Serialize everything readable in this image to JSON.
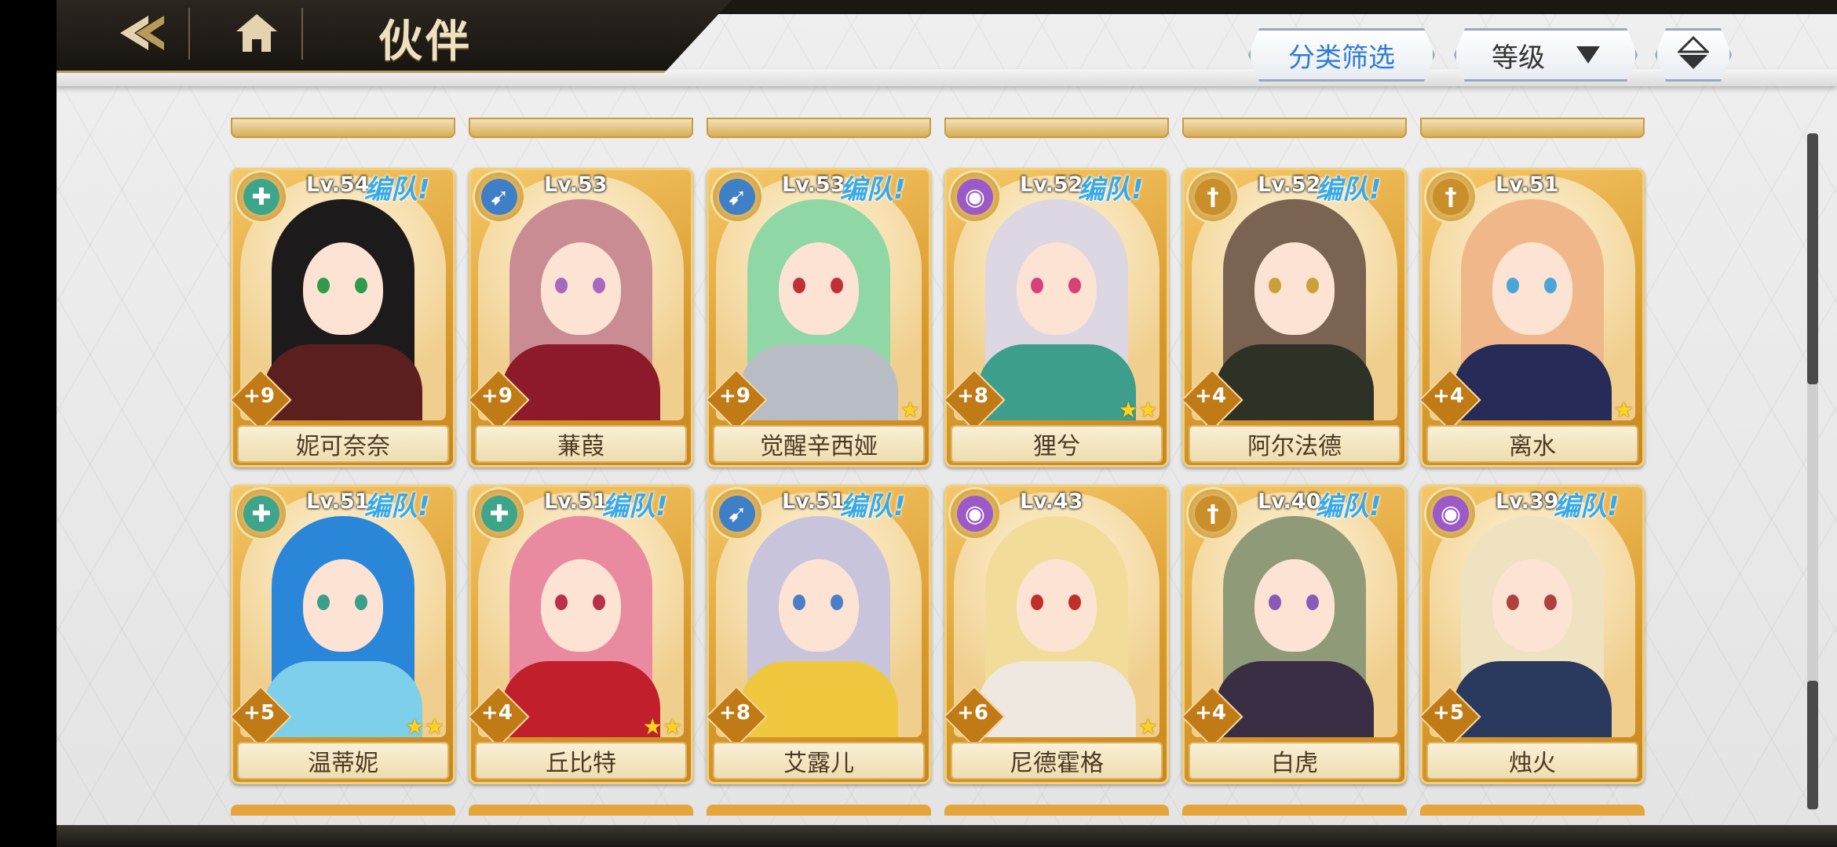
{
  "header": {
    "title": "伙伴",
    "filter_label": "分类筛选",
    "sort_label": "等级",
    "back_icon": "back-arrow-icon",
    "home_icon": "home-icon",
    "order_icon": "sort-order-icon"
  },
  "cards": [
    {
      "name": "妮可奈奈",
      "level": "Lv.54",
      "team": "编队!",
      "plus": "+9",
      "stars": 0,
      "class": "cross",
      "hair": "#1d1a1c",
      "body": "#5a1f1e",
      "eye": "#2c9b4a"
    },
    {
      "name": "蒹葭",
      "level": "Lv.53",
      "team": "",
      "plus": "+9",
      "stars": 0,
      "class": "bow",
      "hair": "#c98c92",
      "body": "#8c1a2a",
      "eye": "#a46ac0"
    },
    {
      "name": "觉醒辛西娅",
      "level": "Lv.53",
      "team": "编队!",
      "plus": "+9",
      "stars": 1,
      "class": "bow",
      "hair": "#8fd7a4",
      "body": "#b8bcc4",
      "eye": "#c0303a"
    },
    {
      "name": "狸兮",
      "level": "Lv.52",
      "team": "编队!",
      "plus": "+8",
      "stars": 2,
      "class": "orb",
      "hair": "#dcd7e2",
      "body": "#3d9e8c",
      "eye": "#d8407a"
    },
    {
      "name": "阿尔法德",
      "level": "Lv.52",
      "team": "编队!",
      "plus": "+4",
      "stars": 0,
      "class": "sword",
      "hair": "#7a6350",
      "body": "#2e3226",
      "eye": "#c9a13a"
    },
    {
      "name": "离水",
      "level": "Lv.51",
      "team": "",
      "plus": "+4",
      "stars": 1,
      "class": "sword",
      "hair": "#f0b88a",
      "body": "#262b58",
      "eye": "#4aa6d8"
    },
    {
      "name": "温蒂妮",
      "level": "Lv.51",
      "team": "编队!",
      "plus": "+5",
      "stars": 2,
      "class": "cross",
      "hair": "#2a86d8",
      "body": "#7ed0ea",
      "eye": "#3a9f88"
    },
    {
      "name": "丘比特",
      "level": "Lv.51",
      "team": "编队!",
      "plus": "+4",
      "stars": 2,
      "class": "cross",
      "hair": "#e98aa0",
      "body": "#c21f2c",
      "eye": "#b8304a"
    },
    {
      "name": "艾露儿",
      "level": "Lv.51",
      "team": "编队!",
      "plus": "+8",
      "stars": 0,
      "class": "bow",
      "hair": "#c8c4dc",
      "body": "#f0c840",
      "eye": "#4a7ec8"
    },
    {
      "name": "尼德霍格",
      "level": "Lv.43",
      "team": "",
      "plus": "+6",
      "stars": 1,
      "class": "orb",
      "hair": "#f2dc9a",
      "body": "#efe8e0",
      "eye": "#c0302a"
    },
    {
      "name": "白虎",
      "level": "Lv.40",
      "team": "编队!",
      "plus": "+4",
      "stars": 0,
      "class": "sword",
      "hair": "#8f9a78",
      "body": "#3a2e44",
      "eye": "#8a5ab8"
    },
    {
      "name": "烛火",
      "level": "Lv.39",
      "team": "编队!",
      "plus": "+5",
      "stars": 0,
      "class": "orb",
      "hair": "#efe2c0",
      "body": "#2a3a5e",
      "eye": "#b04040"
    }
  ]
}
